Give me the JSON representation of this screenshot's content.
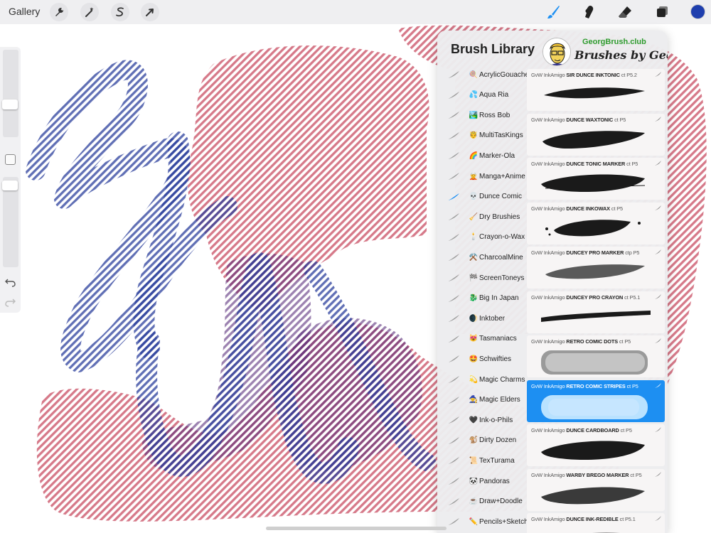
{
  "toolbar": {
    "gallery_label": "Gallery",
    "left_tools": [
      {
        "name": "actions",
        "icon": "wrench-icon"
      },
      {
        "name": "adjustments",
        "icon": "magic-wand-icon"
      },
      {
        "name": "selection",
        "icon": "selection-s-icon"
      },
      {
        "name": "transform",
        "icon": "arrow-cursor-icon"
      }
    ],
    "right_tools": [
      {
        "name": "paint",
        "icon": "brush-icon",
        "active": true
      },
      {
        "name": "smudge",
        "icon": "smudge-finger-icon"
      },
      {
        "name": "erase",
        "icon": "eraser-icon"
      },
      {
        "name": "layers",
        "icon": "layers-icon"
      }
    ],
    "current_color": "#1f3fae"
  },
  "colors": {
    "canvas_blue": "#2b3f9c",
    "canvas_red": "#c0324a",
    "accent_selected": "#1d8ff2",
    "promo_green": "#2e9b2e"
  },
  "library": {
    "title": "Brush Library",
    "promo_site": "GeorgBrush.club",
    "promo_tagline": "Brushes by Georg",
    "sets": [
      {
        "emoji": "🍭",
        "label": "AcrylicGouache"
      },
      {
        "emoji": "💦",
        "label": "Aqua Ria"
      },
      {
        "emoji": "🏞️",
        "label": "Ross Bob"
      },
      {
        "emoji": "🤴",
        "label": "MultiTasKings"
      },
      {
        "emoji": "🌈",
        "label": "Marker-Ola"
      },
      {
        "emoji": "🧝",
        "label": "Manga+Anime"
      },
      {
        "emoji": "💀",
        "label": "Dunce Comic",
        "active": true
      },
      {
        "emoji": "🧹",
        "label": "Dry Brushies"
      },
      {
        "emoji": "🕯️",
        "label": "Crayon-o-Wax"
      },
      {
        "emoji": "⚒️",
        "label": "CharcoalMine"
      },
      {
        "emoji": "🏁",
        "label": "ScreenToneys"
      },
      {
        "emoji": "🐉",
        "label": "Big In Japan"
      },
      {
        "emoji": "🌒",
        "label": "Inktober"
      },
      {
        "emoji": "😻",
        "label": "Tasmaniacs"
      },
      {
        "emoji": "🤩",
        "label": "Schwifties"
      },
      {
        "emoji": "💫",
        "label": "Magic Charms"
      },
      {
        "emoji": "🧙",
        "label": "Magic Elders"
      },
      {
        "emoji": "🖤",
        "label": "Ink-o-Phils"
      },
      {
        "emoji": "🐒",
        "label": "Dirty Dozen"
      },
      {
        "emoji": "📜",
        "label": "TexTurama"
      },
      {
        "emoji": "🐼",
        "label": "Pandoras"
      },
      {
        "emoji": "☕",
        "label": "Draw+Doodle"
      },
      {
        "emoji": "✏️",
        "label": "Pencils+Sketch"
      }
    ],
    "brushes": [
      {
        "prefix": "GvW InkAmigo",
        "name": "SIR DUNCE INKTONIC",
        "tag": "ct P5.2",
        "style": "ink-taper"
      },
      {
        "prefix": "GvW InkAmigo",
        "name": "DUNCE WAXTONIC",
        "tag": "ct P5",
        "style": "wax"
      },
      {
        "prefix": "GvW InkAmigo",
        "name": "DUNCE TONIC MARKER",
        "tag": "ct P5",
        "style": "marker"
      },
      {
        "prefix": "GvW InkAmigo",
        "name": "DUNCE INKOWAX",
        "tag": "ct P5",
        "style": "splatter"
      },
      {
        "prefix": "GvW InkAmigo",
        "name": "DUNCEY PRO MARKER",
        "tag": "ctp P5",
        "style": "grainy"
      },
      {
        "prefix": "GvW InkAmigo",
        "name": "DUNCEY PRO CRAYON",
        "tag": "ct P5.1",
        "style": "crayon"
      },
      {
        "prefix": "GvW InkAmigo",
        "name": "RETRO COMIC DOTS",
        "tag": "ct P5",
        "style": "dots"
      },
      {
        "prefix": "GvW InkAmigo",
        "name": "RETRO COMIC STRIPES",
        "tag": "ct P5",
        "style": "stripes",
        "selected": true
      },
      {
        "prefix": "GvW InkAmigo",
        "name": "DUNCE CARDBOARD",
        "tag": "ct P5",
        "style": "cardboard"
      },
      {
        "prefix": "GvW InkAmigo",
        "name": "WARBY BREGO MARKER",
        "tag": "ct P5",
        "style": "hatch"
      },
      {
        "prefix": "GvW InkAmigo",
        "name": "DUNCE INK-REDIBLE",
        "tag": "ct P5.1",
        "style": "ink"
      }
    ]
  }
}
